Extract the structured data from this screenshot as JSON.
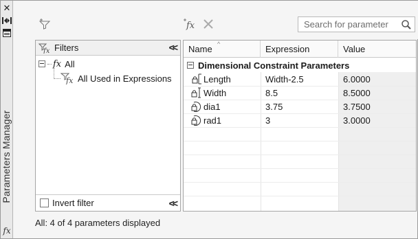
{
  "window": {
    "title": "Parameters Manager",
    "close_glyph": "✕",
    "strip_fx": "fx"
  },
  "toolbar": {
    "fx_label": "fx"
  },
  "search": {
    "placeholder": "Search for parameter"
  },
  "filters": {
    "header": "Filters",
    "collapse_glyph": "<<",
    "tree": [
      {
        "label": "All",
        "prefix": "fx"
      },
      {
        "label": "All Used in Expressions"
      }
    ],
    "invert_label": "Invert filter",
    "invert_checked": false
  },
  "grid": {
    "columns": [
      "Name",
      "Expression",
      "Value"
    ],
    "group_label": "Dimensional Constraint Parameters",
    "rows": [
      {
        "name": "Length",
        "expression": "Width-2.5",
        "value": "6.0000",
        "icon": "linear-dimension-lock-icon"
      },
      {
        "name": "Width",
        "expression": "8.5",
        "value": "8.5000",
        "icon": "vertical-dimension-lock-icon"
      },
      {
        "name": "dia1",
        "expression": "3.75",
        "value": "3.7500",
        "icon": "diameter-lock-icon"
      },
      {
        "name": "rad1",
        "expression": "3",
        "value": "3.0000",
        "icon": "radius-lock-icon"
      }
    ]
  },
  "status": {
    "text": "All: 4 of 4 parameters displayed"
  }
}
